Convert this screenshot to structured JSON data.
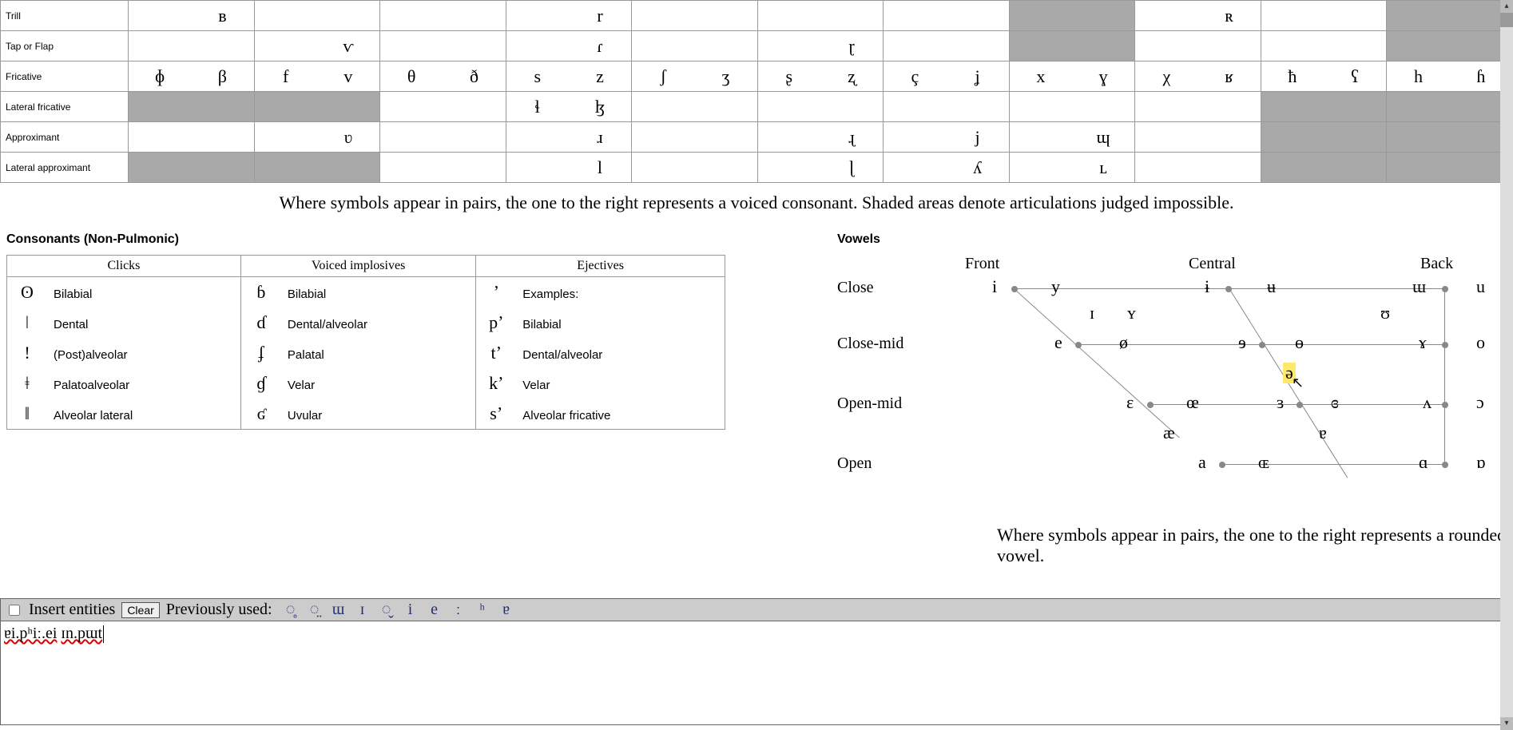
{
  "pulmonic": {
    "rows": [
      {
        "label": "Trill",
        "cells": [
          {
            "l": "",
            "r": "ʙ"
          },
          {
            "l": "",
            "r": ""
          },
          {
            "l": "",
            "r": ""
          },
          {
            "l": "",
            "r": "r"
          },
          {
            "l": "",
            "r": ""
          },
          {
            "l": "",
            "r": ""
          },
          {
            "l": "",
            "r": ""
          },
          {
            "shaded": true
          },
          {
            "l": "",
            "r": "ʀ"
          },
          {
            "l": "",
            "r": ""
          },
          {
            "shaded": true
          }
        ]
      },
      {
        "label": "Tap or Flap",
        "cells": [
          {
            "l": "",
            "r": ""
          },
          {
            "l": "",
            "r": "ⱱ"
          },
          {
            "l": "",
            "r": ""
          },
          {
            "l": "",
            "r": "ɾ"
          },
          {
            "l": "",
            "r": ""
          },
          {
            "l": "",
            "r": "ɽ"
          },
          {
            "l": "",
            "r": ""
          },
          {
            "shaded": true
          },
          {
            "l": "",
            "r": ""
          },
          {
            "l": "",
            "r": ""
          },
          {
            "shaded": true
          }
        ]
      },
      {
        "label": "Fricative",
        "cells": [
          {
            "l": "ɸ",
            "r": "β"
          },
          {
            "l": "f",
            "r": "v"
          },
          {
            "l": "θ",
            "r": "ð"
          },
          {
            "l": "s",
            "r": "z"
          },
          {
            "l": "ʃ",
            "r": "ʒ"
          },
          {
            "l": "ʂ",
            "r": "ʐ"
          },
          {
            "l": "ç",
            "r": "ʝ"
          },
          {
            "l": "x",
            "r": "ɣ"
          },
          {
            "l": "χ",
            "r": "ʁ"
          },
          {
            "l": "ħ",
            "r": "ʕ"
          },
          {
            "l": "h",
            "r": "ɦ"
          }
        ]
      },
      {
        "label": "Lateral fricative",
        "cells": [
          {
            "shaded": true
          },
          {
            "shaded": true
          },
          {
            "l": "",
            "r": ""
          },
          {
            "l": "ɬ",
            "r": "ɮ"
          },
          {
            "l": "",
            "r": ""
          },
          {
            "l": "",
            "r": ""
          },
          {
            "l": "",
            "r": ""
          },
          {
            "l": "",
            "r": ""
          },
          {
            "l": "",
            "r": ""
          },
          {
            "shaded": true
          },
          {
            "shaded": true
          }
        ]
      },
      {
        "label": "Approximant",
        "cells": [
          {
            "l": "",
            "r": ""
          },
          {
            "l": "",
            "r": "ʋ"
          },
          {
            "l": "",
            "r": ""
          },
          {
            "l": "",
            "r": "ɹ"
          },
          {
            "l": "",
            "r": ""
          },
          {
            "l": "",
            "r": "ɻ"
          },
          {
            "l": "",
            "r": "j"
          },
          {
            "l": "",
            "r": "ɰ"
          },
          {
            "l": "",
            "r": ""
          },
          {
            "shaded": true
          },
          {
            "shaded": true
          }
        ]
      },
      {
        "label": "Lateral approximant",
        "cells": [
          {
            "shaded": true
          },
          {
            "shaded": true
          },
          {
            "l": "",
            "r": ""
          },
          {
            "l": "",
            "r": "l"
          },
          {
            "l": "",
            "r": ""
          },
          {
            "l": "",
            "r": "ɭ"
          },
          {
            "l": "",
            "r": "ʎ"
          },
          {
            "l": "",
            "r": "ʟ"
          },
          {
            "l": "",
            "r": ""
          },
          {
            "shaded": true
          },
          {
            "shaded": true
          }
        ]
      }
    ],
    "caption": "Where symbols appear in pairs, the one to the right represents a voiced consonant. Shaded areas denote articulations judged impossible."
  },
  "nonpulmonic": {
    "title": "Consonants (Non-Pulmonic)",
    "headers": [
      "Clicks",
      "Voiced implosives",
      "Ejectives"
    ],
    "rows": [
      [
        {
          "sym": "ʘ",
          "lbl": "Bilabial"
        },
        {
          "sym": "ɓ",
          "lbl": "Bilabial"
        },
        {
          "sym": "ʼ",
          "lbl": "Examples:"
        }
      ],
      [
        {
          "sym": "ǀ",
          "lbl": "Dental"
        },
        {
          "sym": "ɗ",
          "lbl": "Dental/alveolar"
        },
        {
          "sym": "pʼ",
          "lbl": "Bilabial"
        }
      ],
      [
        {
          "sym": "ǃ",
          "lbl": "(Post)alveolar"
        },
        {
          "sym": "ʄ",
          "lbl": "Palatal"
        },
        {
          "sym": "tʼ",
          "lbl": "Dental/alveolar"
        }
      ],
      [
        {
          "sym": "ǂ",
          "lbl": "Palatoalveolar"
        },
        {
          "sym": "ɠ",
          "lbl": "Velar"
        },
        {
          "sym": "kʼ",
          "lbl": "Velar"
        }
      ],
      [
        {
          "sym": "ǁ",
          "lbl": "Alveolar lateral"
        },
        {
          "sym": "ʛ",
          "lbl": "Uvular"
        },
        {
          "sym": "sʼ",
          "lbl": "Alveolar fricative"
        }
      ]
    ]
  },
  "vowels": {
    "title": "Vowels",
    "col_heads": {
      "front": "Front",
      "central": "Central",
      "back": "Back"
    },
    "row_labels": {
      "close": "Close",
      "closemid": "Close-mid",
      "openmid": "Open-mid",
      "open": "Open"
    },
    "symbols": {
      "i": "i",
      "y": "y",
      "ibar": "ɨ",
      "ubar": "ʉ",
      "uu": "ɯ",
      "u": "u",
      "smI": "ɪ",
      "smY": "ʏ",
      "smU": "ʊ",
      "e": "e",
      "oslash": "ø",
      "reve": "ɘ",
      "barO": "ɵ",
      "ramshorn": "ɤ",
      "o": "o",
      "schwa": "ə",
      "eps": "ɛ",
      "oe": "œ",
      "revEps": "ɜ",
      "revEpsClose": "ɞ",
      "turnedV": "ʌ",
      "openO": "ɔ",
      "ae": "æ",
      "turnA": "ɐ",
      "a": "a",
      "OE": "ɶ",
      "scriptA": "ɑ",
      "turnScriptA": "ɒ"
    },
    "caption": "Where symbols appear in pairs, the one to the right represents a rounded vowel."
  },
  "toolbar": {
    "insert_label": "Insert entities",
    "clear_label": "Clear",
    "previous_label": "Previously used:",
    "previous": [
      "◌̥",
      "◌̤",
      "ɯ",
      "ɪ",
      "◌̬",
      "i",
      "e",
      "ː",
      "ʰ",
      "ɐ"
    ]
  },
  "editor": {
    "value_parts": [
      {
        "text": "ɐi.pʰiː.ei",
        "spell": true
      },
      {
        "text": " "
      },
      {
        "text": "ɪn.pɯt",
        "spell": true
      }
    ]
  }
}
